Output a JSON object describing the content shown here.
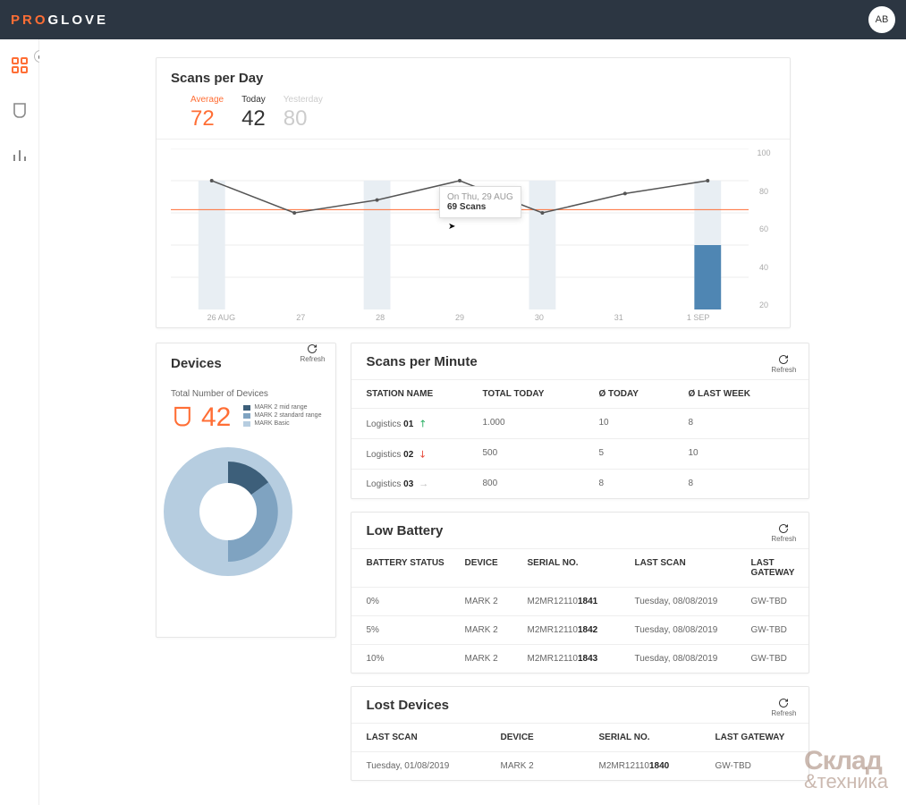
{
  "header": {
    "logo_pre": "PRO",
    "logo_post": "GLOVE",
    "avatar": "AB"
  },
  "nav": {
    "items": [
      "dashboard",
      "device",
      "bars"
    ]
  },
  "scans_per_day": {
    "title": "Scans per Day",
    "stats": {
      "avg_label": "Average",
      "avg_value": "72",
      "today_label": "Today",
      "today_value": "42",
      "yesterday_label": "Yesterday",
      "yesterday_value": "80"
    },
    "tooltip": {
      "line1": "On Thu, 29 AUG",
      "line2": "69 Scans"
    }
  },
  "chart_data": {
    "type": "line",
    "title": "Scans per Day",
    "xlabel": "",
    "ylabel": "",
    "ylim": [
      0,
      100
    ],
    "yticks": [
      100,
      80,
      60,
      40,
      20
    ],
    "categories": [
      "26 AUG",
      "27",
      "28",
      "29",
      "30",
      "31",
      "1 SEP"
    ],
    "series": [
      {
        "name": "Scans",
        "values": [
          80,
          60,
          68,
          80,
          60,
          72,
          80
        ]
      }
    ],
    "reference_lines": [
      {
        "name": "Average",
        "value": 62,
        "color": "#ff6e35"
      }
    ],
    "bar_overlay": {
      "name": "Today",
      "category": "1 SEP",
      "value": 40,
      "color": "#4f86b3"
    },
    "background_bands_alternate": true,
    "tooltip": {
      "category": "29",
      "date_text": "Thu, 29 AUG",
      "value": 69
    }
  },
  "devices": {
    "title": "Devices",
    "refresh": "Refresh",
    "subtitle": "Total Number of Devices",
    "total": "42",
    "legend": [
      {
        "label": "MARK 2 mid range",
        "color": "#3d5f7a"
      },
      {
        "label": "MARK 2 standard range",
        "color": "#7fa3c1"
      },
      {
        "label": "MARK Basic",
        "color": "#b6cde0"
      }
    ],
    "donut_data": {
      "type": "pie",
      "values": [
        15,
        35,
        50
      ],
      "colors": [
        "#3d5f7a",
        "#7fa3c1",
        "#b6cde0"
      ],
      "inner_radius_pct": 55
    }
  },
  "spm": {
    "title": "Scans per Minute",
    "refresh": "Refresh",
    "headers": {
      "c1": "STATION NAME",
      "c2": "TOTAL TODAY",
      "c3": "Ø TODAY",
      "c4": "Ø LAST WEEK"
    },
    "rows": [
      {
        "name_pre": "Logistics ",
        "name_bold": "01",
        "trend": "up",
        "total": "1.000",
        "avg_today": "10",
        "avg_week": "8"
      },
      {
        "name_pre": "Logistics ",
        "name_bold": "02",
        "trend": "down",
        "total": "500",
        "avg_today": "5",
        "avg_week": "10"
      },
      {
        "name_pre": "Logistics ",
        "name_bold": "03",
        "trend": "flat",
        "total": "800",
        "avg_today": "8",
        "avg_week": "8"
      }
    ]
  },
  "low_battery": {
    "title": "Low Battery",
    "refresh": "Refresh",
    "headers": {
      "c1": "BATTERY STATUS",
      "c2": "DEVICE",
      "c3": "SERIAL NO.",
      "c4": "LAST SCAN",
      "c5": "LAST GATEWAY"
    },
    "rows": [
      {
        "status": "0%",
        "device": "MARK 2",
        "serial_pre": "M2MR12110",
        "serial_bold": "1841",
        "last_scan": "Tuesday, 08/08/2019",
        "gw": "GW-TBD"
      },
      {
        "status": "5%",
        "device": "MARK 2",
        "serial_pre": "M2MR12110",
        "serial_bold": "1842",
        "last_scan": "Tuesday, 08/08/2019",
        "gw": "GW-TBD"
      },
      {
        "status": "10%",
        "device": "MARK 2",
        "serial_pre": "M2MR12110",
        "serial_bold": "1843",
        "last_scan": "Tuesday, 08/08/2019",
        "gw": "GW-TBD"
      }
    ]
  },
  "lost_devices": {
    "title": "Lost Devices",
    "refresh": "Refresh",
    "headers": {
      "c1": "LAST SCAN",
      "c2": "DEVICE",
      "c3": "SERIAL NO.",
      "c4": "LAST GATEWAY"
    },
    "rows": [
      {
        "last_scan": "Tuesday, 01/08/2019",
        "device": "MARK 2",
        "serial_pre": "M2MR12110",
        "serial_bold": "1840",
        "gw": "GW-TBD"
      }
    ]
  },
  "watermark": {
    "l1": "Склад",
    "l2": "&техника"
  }
}
